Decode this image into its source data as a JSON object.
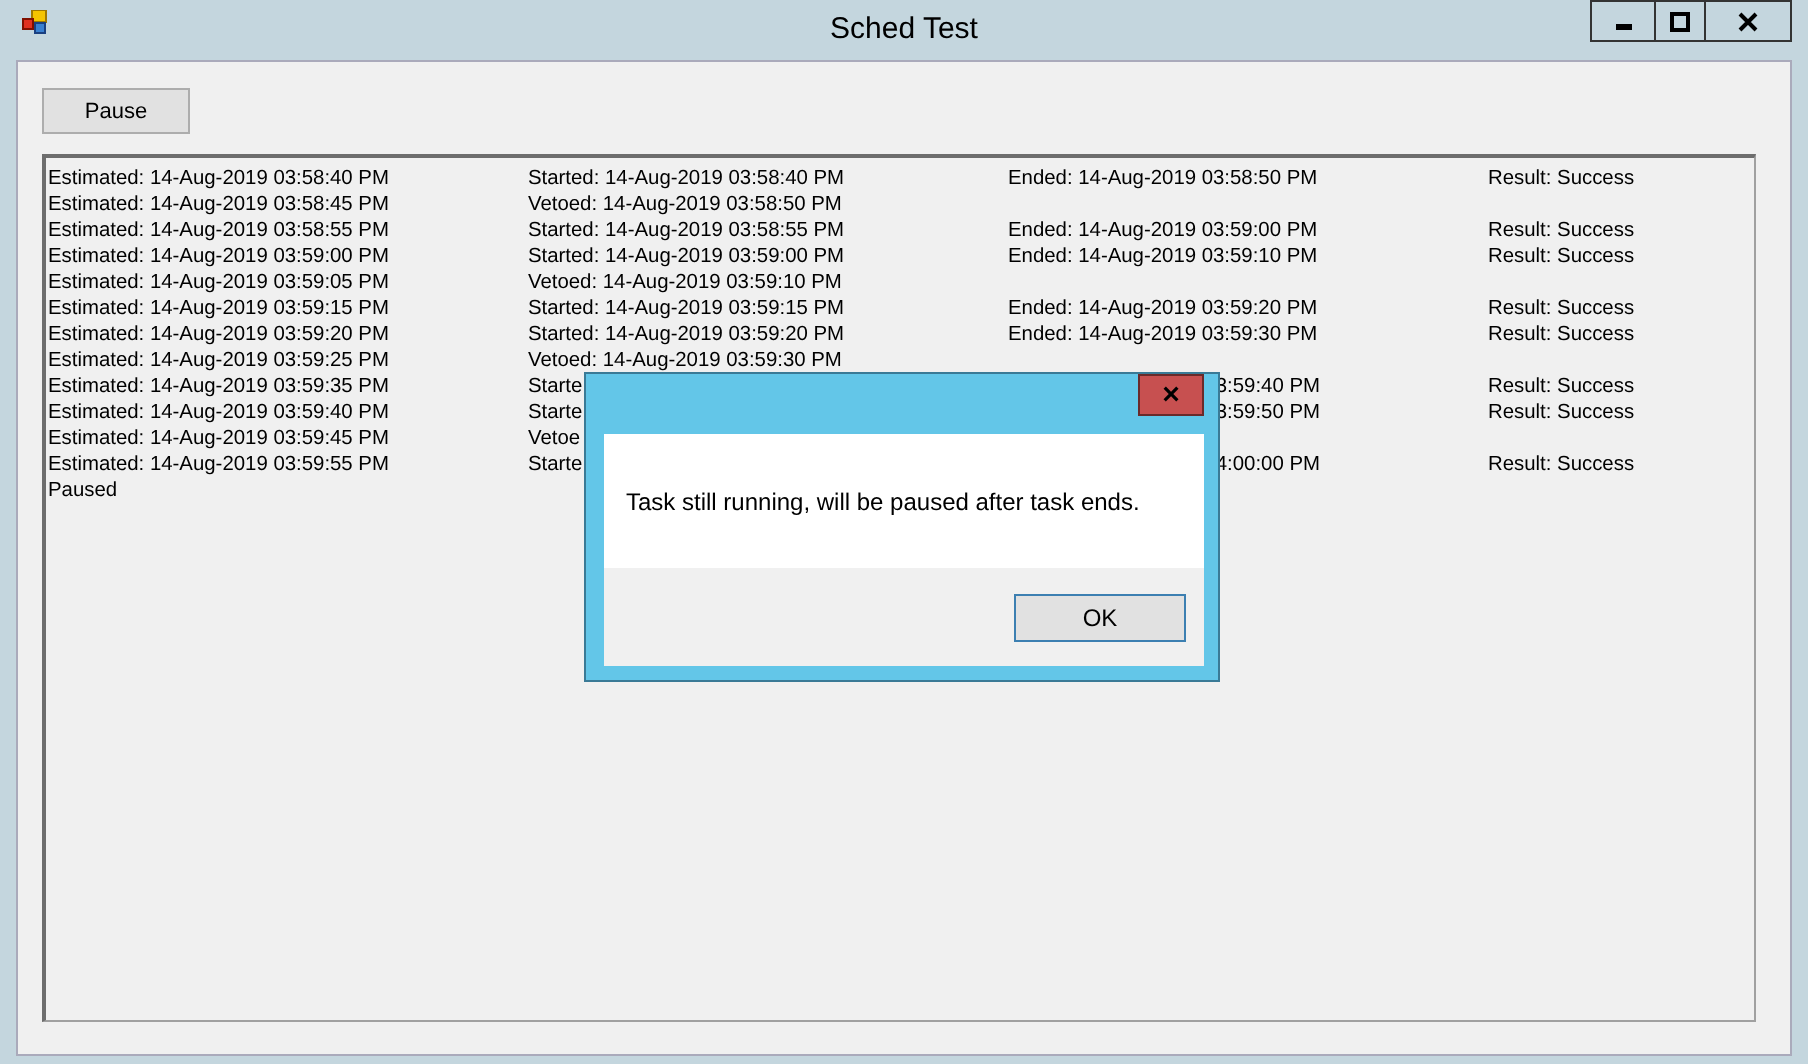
{
  "window": {
    "title": "Sched Test"
  },
  "pause_button": {
    "label": "Pause"
  },
  "log": {
    "rows": [
      {
        "estimated": "Estimated: 14-Aug-2019 03:58:40 PM",
        "action": "Started: 14-Aug-2019 03:58:40 PM",
        "ended": "Ended: 14-Aug-2019 03:58:50 PM",
        "result": "Result: Success"
      },
      {
        "estimated": "Estimated: 14-Aug-2019 03:58:45 PM",
        "action": "Vetoed: 14-Aug-2019 03:58:50 PM"
      },
      {
        "estimated": "Estimated: 14-Aug-2019 03:58:55 PM",
        "action": "Started: 14-Aug-2019 03:58:55 PM",
        "ended": "Ended: 14-Aug-2019 03:59:00 PM",
        "result": "Result: Success"
      },
      {
        "estimated": "Estimated: 14-Aug-2019 03:59:00 PM",
        "action": "Started: 14-Aug-2019 03:59:00 PM",
        "ended": "Ended: 14-Aug-2019 03:59:10 PM",
        "result": "Result: Success"
      },
      {
        "estimated": "Estimated: 14-Aug-2019 03:59:05 PM",
        "action": "Vetoed: 14-Aug-2019 03:59:10 PM"
      },
      {
        "estimated": "Estimated: 14-Aug-2019 03:59:15 PM",
        "action": "Started: 14-Aug-2019 03:59:15 PM",
        "ended": "Ended: 14-Aug-2019 03:59:20 PM",
        "result": "Result: Success"
      },
      {
        "estimated": "Estimated: 14-Aug-2019 03:59:20 PM",
        "action": "Started: 14-Aug-2019 03:59:20 PM",
        "ended": "Ended: 14-Aug-2019 03:59:30 PM",
        "result": "Result: Success"
      },
      {
        "estimated": "Estimated: 14-Aug-2019 03:59:25 PM",
        "action": "Vetoed: 14-Aug-2019 03:59:30 PM"
      },
      {
        "estimated": "Estimated: 14-Aug-2019 03:59:35 PM",
        "action": "Starte",
        "ended": "3:59:40 PM",
        "ended_cut_left": true,
        "result": "Result: Success"
      },
      {
        "estimated": "Estimated: 14-Aug-2019 03:59:40 PM",
        "action": "Starte",
        "ended": "3:59:50 PM",
        "ended_cut_left": true,
        "result": "Result: Success"
      },
      {
        "estimated": "Estimated: 14-Aug-2019 03:59:45 PM",
        "action": "Vetoe"
      },
      {
        "estimated": "Estimated: 14-Aug-2019 03:59:55 PM",
        "action": "Starte",
        "ended": "4:00:00 PM",
        "ended_cut_left": true,
        "result": "Result: Success"
      }
    ],
    "footer": "Paused"
  },
  "dialog": {
    "message": "Task still running, will be paused after task ends.",
    "close": "×",
    "button": "OK"
  }
}
